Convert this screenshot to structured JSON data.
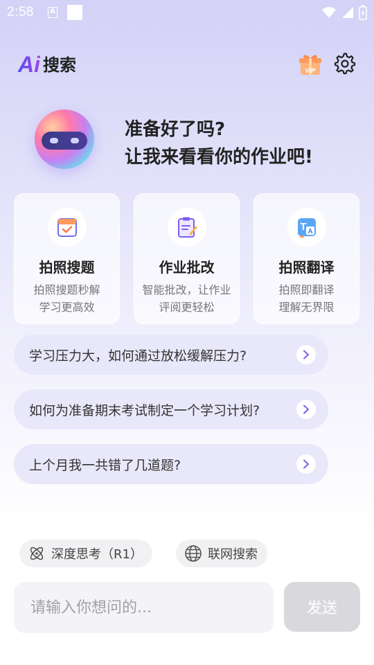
{
  "status_bar": {
    "time": "2:58",
    "notification_letter": "A",
    "icons": [
      "wifi-icon",
      "signal-icon",
      "battery-charging-icon"
    ]
  },
  "header": {
    "logo_ai": "Ai",
    "logo_text": "搜索",
    "vip_label": "VIP",
    "icons": [
      "vip-gift-icon",
      "gear-icon"
    ]
  },
  "hero": {
    "line1": "准备好了吗?",
    "line2": "让我来看看你的作业吧!"
  },
  "features": [
    {
      "title": "拍照搜题",
      "desc1": "拍照搜题秒解",
      "desc2": "学习更高效",
      "icon": "calendar-check-icon"
    },
    {
      "title": "作业批改",
      "desc1": "智能批改，让作业",
      "desc2": "评阅更轻松",
      "icon": "clipboard-pencil-icon"
    },
    {
      "title": "拍照翻译",
      "desc1": "拍照即翻译",
      "desc2": "理解无界限",
      "icon": "translate-icon"
    }
  ],
  "suggestions": [
    "学习压力大，如何通过放松缓解压力?",
    "如何为准备期末考试制定一个学习计划?",
    "上个月我一共错了几道题?"
  ],
  "chips": {
    "deep_think": "深度思考（R1）",
    "web_search": "联网搜索"
  },
  "composer": {
    "placeholder": "请输入你想问的...",
    "value": "",
    "send_label": "发送"
  },
  "colors": {
    "accent": "#7c5cf0",
    "send_disabled": "#d9d9dd",
    "background_top": "#d3d2f7"
  }
}
